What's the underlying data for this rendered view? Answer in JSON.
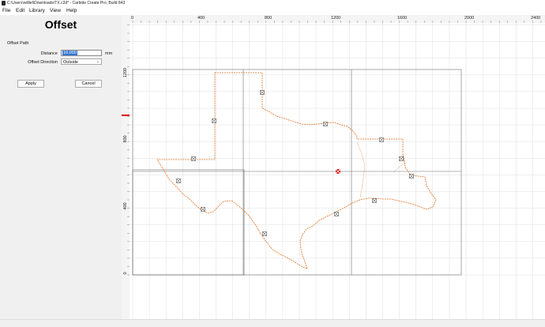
{
  "window": {
    "title": "C:\\Users\\williel\\Downloads\\TX.c2d* - Carbide Create Pro, Build 843"
  },
  "menu": {
    "file": "File",
    "edit": "Edit",
    "library": "Library",
    "view": "View",
    "help": "Help"
  },
  "panel": {
    "title": "Offset",
    "section": "Offset Path",
    "distance_label": "Distance",
    "distance_value": "10.000",
    "distance_unit": "mm",
    "direction_label": "Offset Direction",
    "direction_value": "Outside",
    "apply_label": "Apply",
    "cancel_label": "Cancel"
  },
  "ruler": {
    "x_labels": [
      "0",
      "400",
      "800",
      "1200",
      "1600",
      "2000",
      "2400"
    ],
    "y_labels": [
      "1200",
      "800",
      "400",
      "0"
    ]
  },
  "colors": {
    "path": "#e07020",
    "grid": "#d9d9d9",
    "stock": "#707070",
    "origin_marker": "#e00000"
  }
}
